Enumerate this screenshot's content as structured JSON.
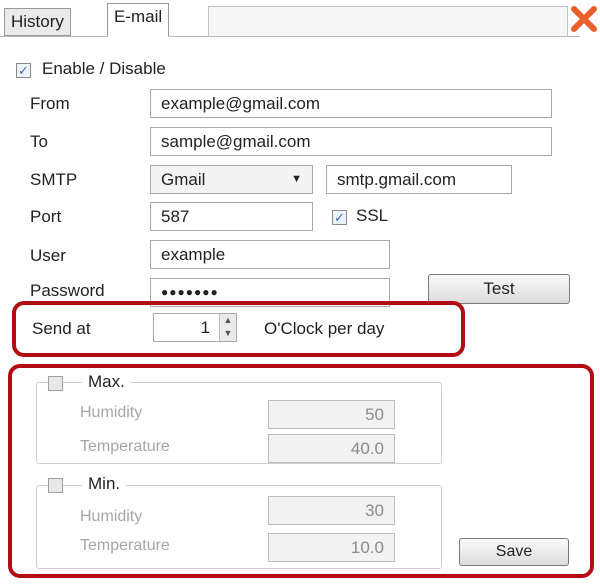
{
  "tabs": [
    {
      "label": "History"
    },
    {
      "label": "E-mail"
    }
  ],
  "enable": {
    "label": "Enable / Disable",
    "checked": true
  },
  "form": {
    "from_label": "From",
    "from_value": "example@gmail.com",
    "to_label": "To",
    "to_value": "sample@gmail.com",
    "smtp_label": "SMTP",
    "smtp_provider": "Gmail",
    "smtp_server": "smtp.gmail.com",
    "port_label": "Port",
    "port_value": "587",
    "ssl_label": "SSL",
    "ssl_checked": true,
    "user_label": "User",
    "user_value": "example",
    "password_label": "Password",
    "password_value": "●●●●●●●",
    "test_label": "Test"
  },
  "schedule": {
    "send_at_label": "Send at",
    "hour_value": "1",
    "suffix_label": "O'Clock per day"
  },
  "thresholds": {
    "max": {
      "title": "Max.",
      "humidity_label": "Humidity",
      "humidity_value": "50",
      "temperature_label": "Temperature",
      "temperature_value": "40.0"
    },
    "min": {
      "title": "Min.",
      "humidity_label": "Humidity",
      "humidity_value": "30",
      "temperature_label": "Temperature",
      "temperature_value": "10.0"
    },
    "save_label": "Save"
  },
  "icons": {
    "close": "close-icon",
    "check": "check-icon",
    "dropdown": "chevron-down-icon",
    "spinner": "spinner-arrows-icon"
  },
  "colors": {
    "highlight": "#b30d14",
    "close": "#e8612c",
    "check": "#3a6bb8"
  }
}
